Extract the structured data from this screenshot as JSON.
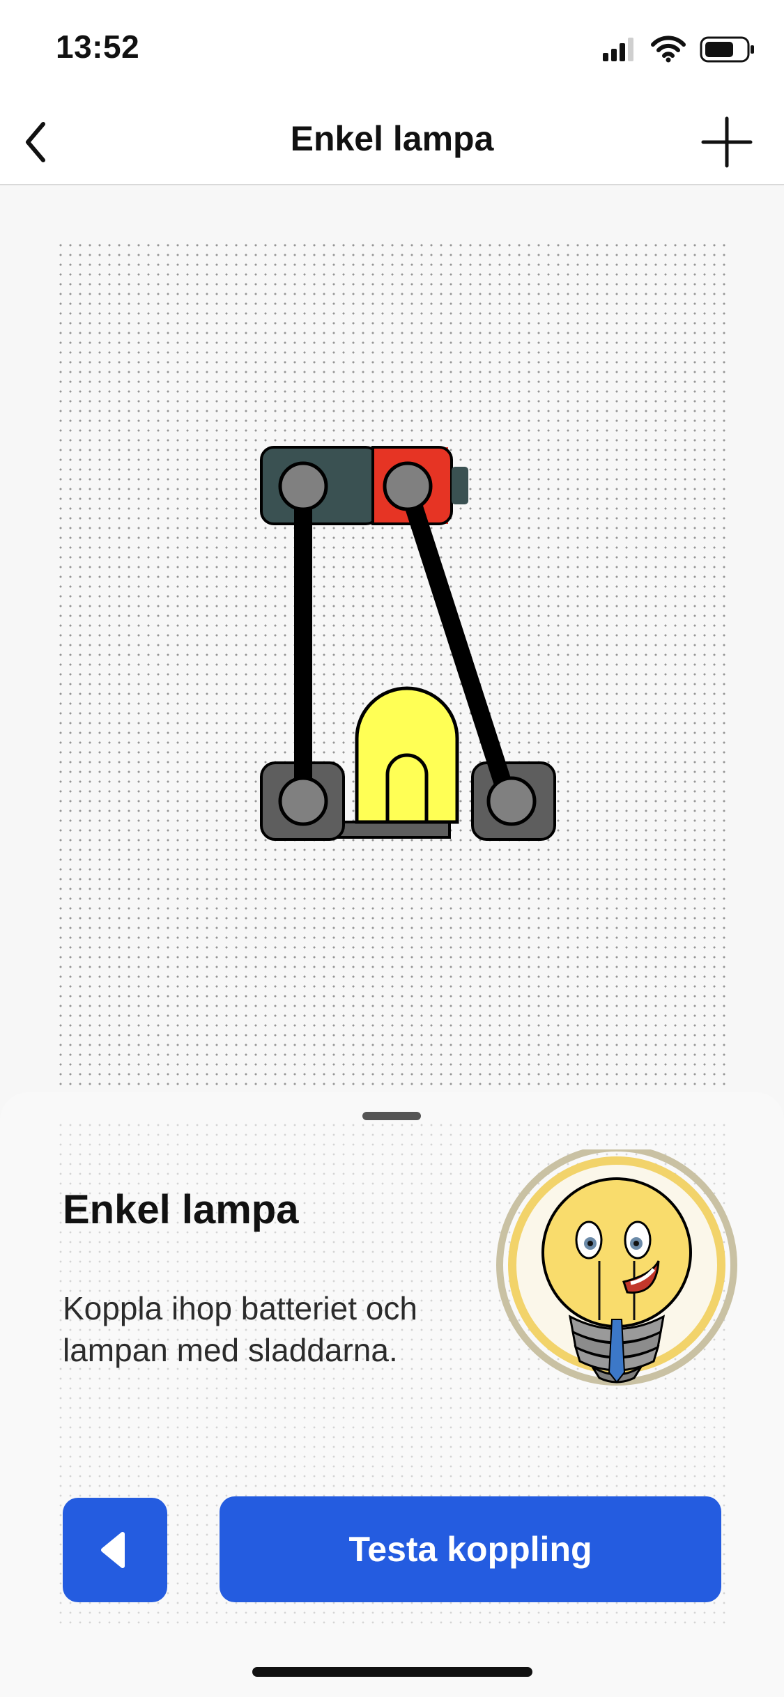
{
  "status_bar": {
    "time": "13:52",
    "icons": [
      "signal-icon",
      "wifi-icon",
      "battery-icon"
    ]
  },
  "nav": {
    "title": "Enkel lampa",
    "back_icon": "chevron-left-icon",
    "add_icon": "plus-icon"
  },
  "circuit": {
    "components": [
      "battery",
      "lamp",
      "wire",
      "wire"
    ],
    "colors": {
      "battery_body": "#3a5152",
      "battery_positive": "#e63424",
      "terminal": "#808080",
      "lamp_bulb": "#ffff55",
      "lamp_base": "#5e5e5e",
      "wire": "#000000"
    }
  },
  "sheet": {
    "title": "Enkel lampa",
    "description": "Koppla ihop batteriet och lampan med sladdarna.",
    "mascot_icon": "lightbulb-character-icon",
    "back_button_icon": "triangle-left-icon",
    "test_button_label": "Testa koppling",
    "accent_color": "#245ce0"
  }
}
